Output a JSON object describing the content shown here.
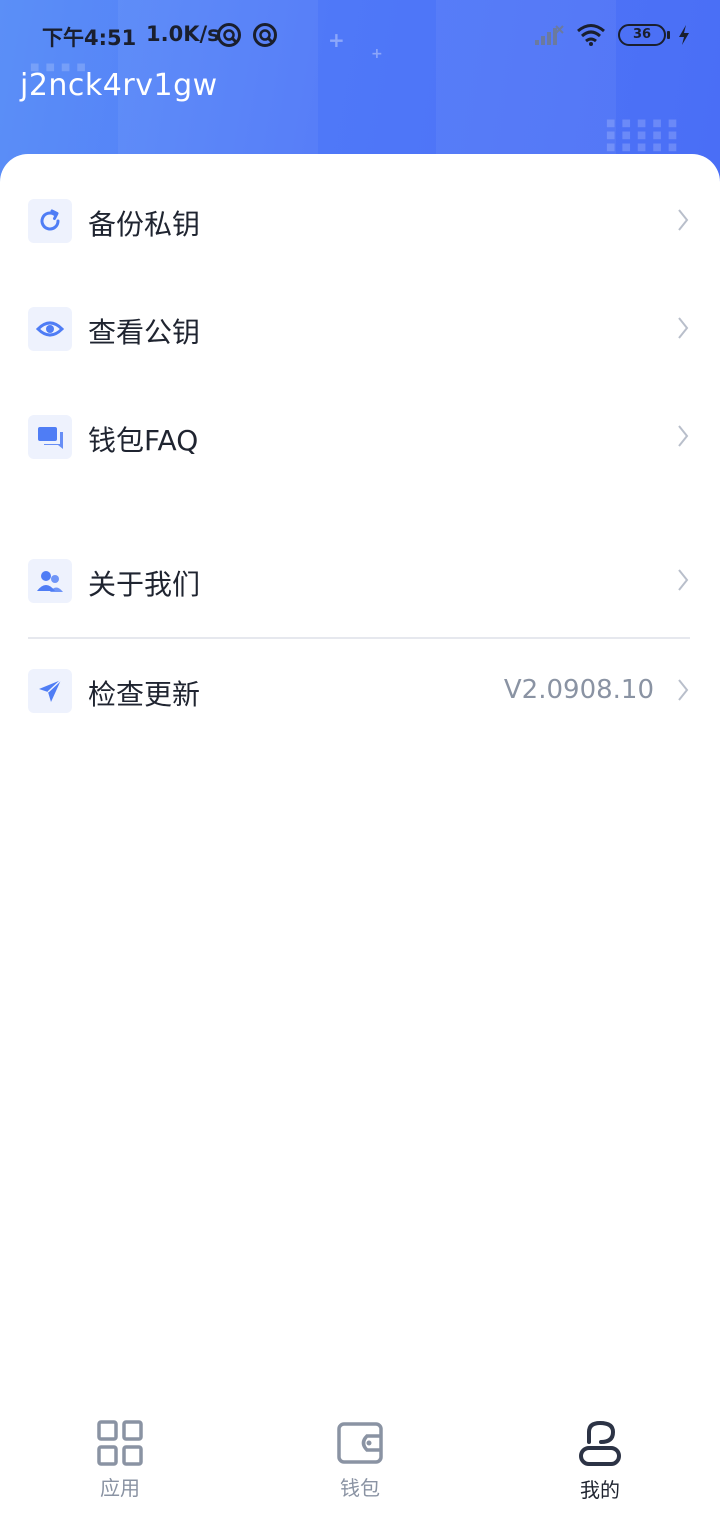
{
  "status_bar": {
    "time": "下午4:51",
    "net_speed": "1.0K/s",
    "battery": "36"
  },
  "header": {
    "username": "j2nck4rv1gw"
  },
  "menu": {
    "items": [
      {
        "label": "备份私钥",
        "icon": "refresh-icon"
      },
      {
        "label": "查看公钥",
        "icon": "eye-icon"
      },
      {
        "label": "钱包FAQ",
        "icon": "chat-icon"
      },
      {
        "label": "关于我们",
        "icon": "users-icon"
      },
      {
        "label": "检查更新",
        "icon": "send-icon",
        "value": "V2.0908.10"
      }
    ]
  },
  "tabbar": {
    "tabs": [
      {
        "label": "应用",
        "icon": "grid-icon",
        "active": false
      },
      {
        "label": "钱包",
        "icon": "wallet-icon",
        "active": false
      },
      {
        "label": "我的",
        "icon": "profile-icon",
        "active": true
      }
    ]
  },
  "colors": {
    "header_gradient_start": "#5b8ff7",
    "header_gradient_end": "#4a6ef6",
    "icon_accent": "#4f7df5",
    "icon_bg": "#eef2fd",
    "text_primary": "#1f2430",
    "text_secondary": "#8a93a3"
  }
}
